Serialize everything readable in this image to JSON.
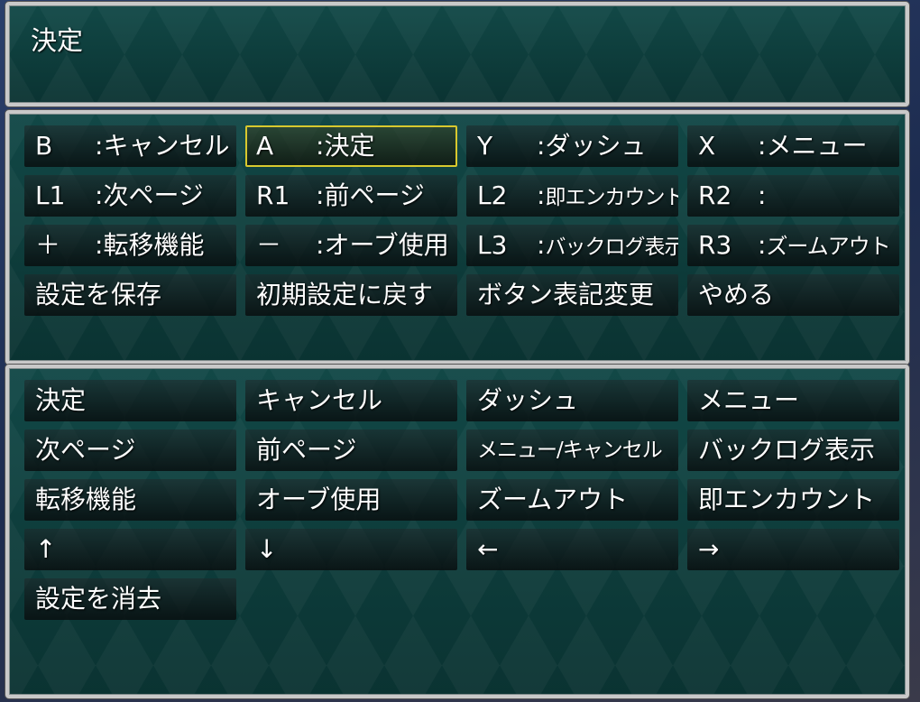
{
  "help": {
    "text": "決定"
  },
  "keys": [
    {
      "key": "B",
      "sep": ":",
      "action": "キャンセル"
    },
    {
      "key": "A",
      "sep": ":",
      "action": "決定",
      "selected": true
    },
    {
      "key": "Y",
      "sep": ":",
      "action": "ダッシュ"
    },
    {
      "key": "X",
      "sep": ":",
      "action": "メニュー"
    },
    {
      "key": "L1",
      "sep": ":",
      "action": "次ページ"
    },
    {
      "key": "R1",
      "sep": ":",
      "action": "前ページ"
    },
    {
      "key": "L2",
      "sep": ":",
      "action": "即エンカウント"
    },
    {
      "key": "R2",
      "sep": ":",
      "action": ""
    },
    {
      "key": "＋",
      "sep": ":",
      "action": "転移機能"
    },
    {
      "key": "－",
      "sep": ":",
      "action": "オーブ使用"
    },
    {
      "key": "L3",
      "sep": ":",
      "action": "バックログ表示"
    },
    {
      "key": "R3",
      "sep": ":",
      "action": "ズームアウト"
    }
  ],
  "commands": [
    {
      "label": "設定を保存"
    },
    {
      "label": "初期設定に戻す"
    },
    {
      "label": "ボタン表記変更"
    },
    {
      "label": "やめる"
    }
  ],
  "actions": [
    "決定",
    "キャンセル",
    "ダッシュ",
    "メニュー",
    "次ページ",
    "前ページ",
    "メニュー/キャンセル",
    "バックログ表示",
    "転移機能",
    "オーブ使用",
    "ズームアウト",
    "即エンカウント",
    "↑",
    "↓",
    "←",
    "→",
    "設定を消去"
  ]
}
